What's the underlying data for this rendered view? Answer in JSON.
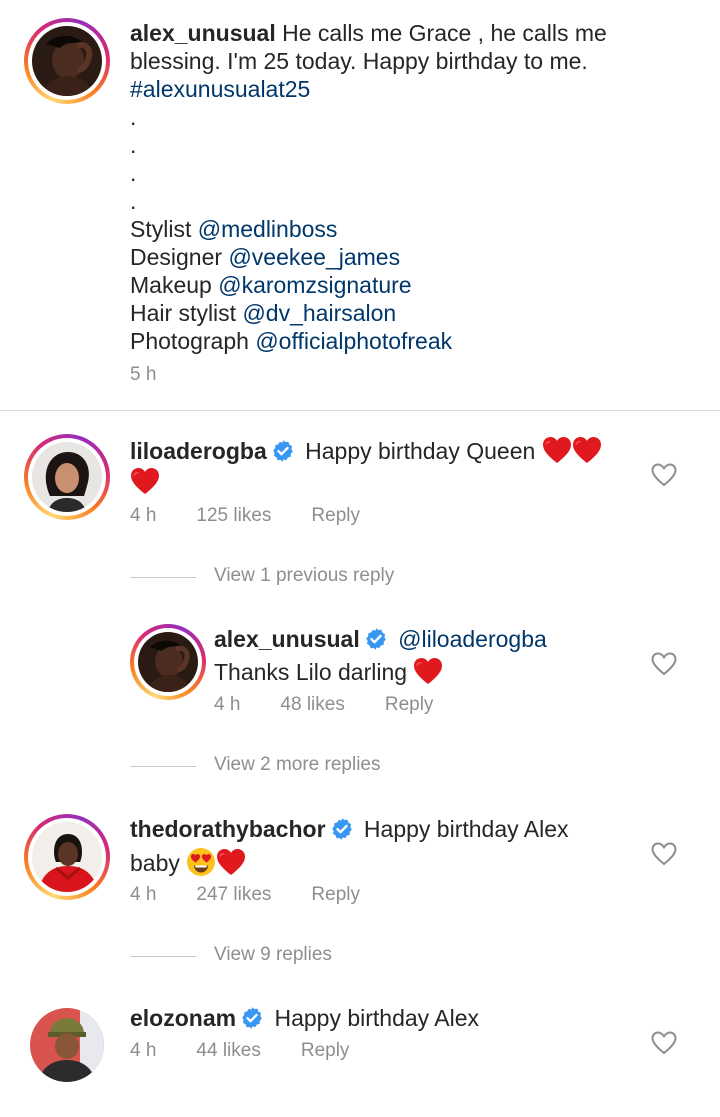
{
  "caption": {
    "username": "alex_unusual",
    "line1": "He calls me Grace ,  he calls me",
    "line2": "blessing.  I'm 25 today.  Happy birthday to me.",
    "hashtag": "#alexunusualat25",
    "dots": [
      ".",
      ".",
      ".",
      "."
    ],
    "credits": [
      {
        "role": "Stylist",
        "handle": "@medlinboss"
      },
      {
        "role": "Designer",
        "handle": "@veekee_james"
      },
      {
        "role": "Makeup",
        "handle": "@karomzsignature"
      },
      {
        "role": "Hair stylist",
        "handle": "@dv_hairsalon"
      },
      {
        "role": "Photograph",
        "handle": "@officialphotofreak"
      }
    ],
    "time": "5 h"
  },
  "comments": [
    {
      "username": "liloaderogba",
      "text": "Happy birthday Queen",
      "time": "4 h",
      "likes": "125 likes",
      "reply": "Reply",
      "view_replies": "View 1 previous reply"
    },
    {
      "username": "alex_unusual",
      "mention": "@liloaderogba",
      "text": "Thanks Lilo darling",
      "time": "4 h",
      "likes": "48 likes",
      "reply": "Reply",
      "view_replies": "View 2 more replies"
    },
    {
      "username": "thedorathybachor",
      "text": "Happy birthday Alex",
      "text2": "baby",
      "time": "4 h",
      "likes": "247 likes",
      "reply": "Reply",
      "view_replies": "View 9 replies"
    },
    {
      "username": "elozonam",
      "text": "Happy birthday Alex",
      "time": "4 h",
      "likes": "44 likes",
      "reply": "Reply"
    }
  ],
  "colors": {
    "verified": "#3897f0",
    "heart": "#e0191f",
    "link": "#00376b",
    "meta": "#8e8e8e"
  },
  "icons": [
    "verified-badge-icon",
    "red-heart-emoji",
    "heart-eyes-emoji",
    "like-heart-icon"
  ]
}
